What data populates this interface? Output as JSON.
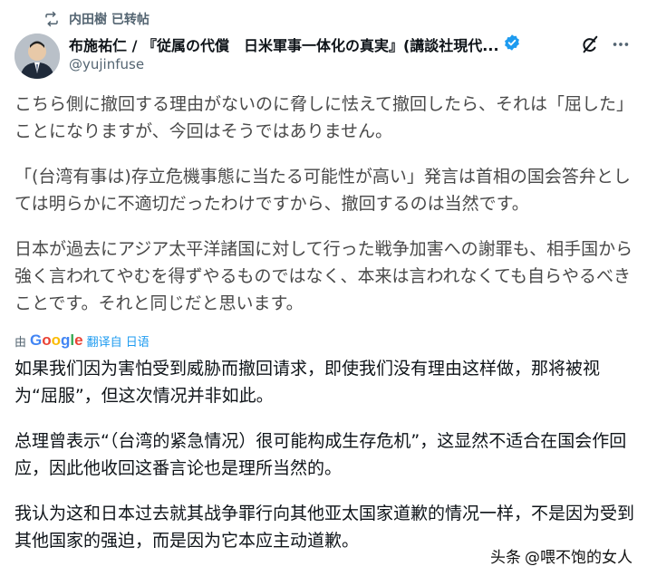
{
  "repost": {
    "icon": "repost-icon",
    "text": "内田樹 已转帖"
  },
  "author": {
    "name": "布施祐仁 / 『従属の代償　日米軍事一体化の真実』(講談社現代...",
    "handle": "@yujinfuse",
    "verified_color": "#1d9bf0"
  },
  "original": {
    "paragraphs": [
      "こちら側に撤回する理由がないのに脅しに怯えて撤回したら、それは「屈した」ことになりますが、今回はそうではありません。",
      "「(台湾有事は)存立危機事態に当たる可能性が高い」発言は首相の国会答弁としては明らかに不適切だったわけですから、撤回するのは当然です。",
      "日本が過去にアジア太平洋諸国に対して行った戦争加害への謝罪も、相手国から強く言われてやむを得ずやるものではなく、本来は言われなくても自らやるべきことです。それと同じだと思います。"
    ]
  },
  "translation_bar": {
    "by": "由",
    "provider": "Google",
    "link": "翻译自 日语"
  },
  "translated": {
    "paragraphs": [
      "如果我们因为害怕受到威胁而撤回请求，即使我们没有理由这样做，那将被视为“屈服”，但这次情况并非如此。",
      "总理曾表示“（台湾的紧急情况）很可能构成生存危机”，这显然不适合在国会作回应，因此他收回这番言论也是理所当然的。",
      "我认为这和日本过去就其战争罪行向其他亚太国家道歉的情况一样，不是因为受到其他国家的强迫，而是因为它本应主动道歉。"
    ]
  },
  "watermark": {
    "prefix": "头条",
    "account": "@喂不饱的女人"
  }
}
